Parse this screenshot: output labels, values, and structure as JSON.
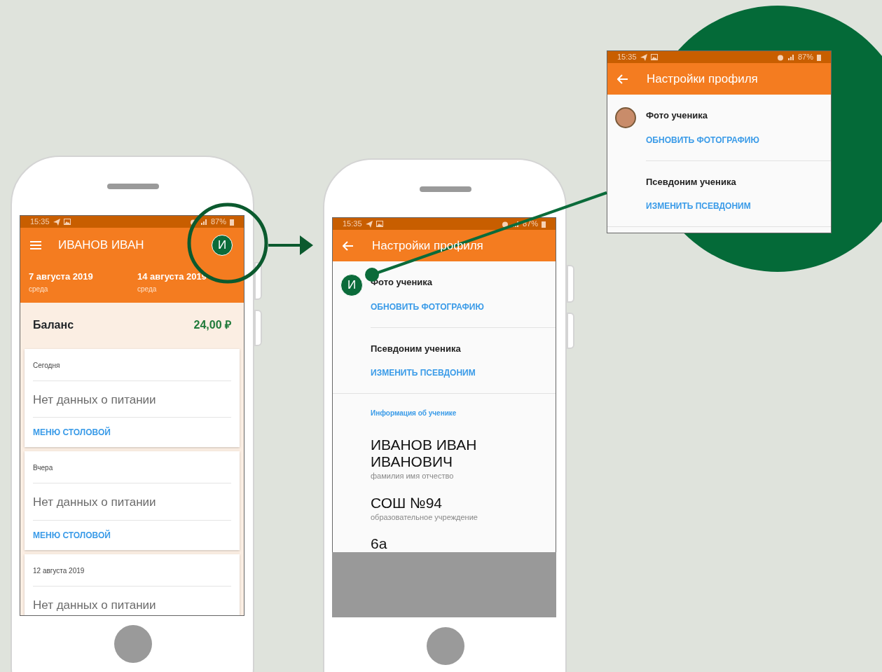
{
  "main_screen": {
    "status_time": "15:35",
    "battery": "87%",
    "title": "ИВАНОВ ИВАН",
    "avatar_letter": "И",
    "weeks": [
      {
        "date": "7 августа 2019",
        "day": "среда"
      },
      {
        "date": "14 августа 2019",
        "day": "среда"
      }
    ],
    "balance_label": "Баланс",
    "balance": "24,00 ₽",
    "days": [
      {
        "label": "Сегодня",
        "message": "Нет данных о питании",
        "link": "МЕНЮ СТОЛОВОЙ"
      },
      {
        "label": "Вчера",
        "message": "Нет данных о питании",
        "link": "МЕНЮ СТОЛОВОЙ"
      },
      {
        "label": "12 августа 2019",
        "message": "Нет данных о питании"
      }
    ]
  },
  "profile_screen": {
    "status_time": "15:35",
    "battery": "87%",
    "title": "Настройки профиля",
    "avatar_letter": "И",
    "rows": [
      {
        "title": "Фото ученика",
        "action": "ОБНОВИТЬ ФОТОГРАФИЮ"
      },
      {
        "title": "Псевдоним ученика",
        "action": "ИЗМЕНИТЬ ПСЕВДОНИМ"
      }
    ],
    "section": "Информация об ученике",
    "fields": [
      {
        "value": "ИВАНОВ ИВАН ИВАНОВИЧ",
        "caption": "фамилия имя отчество"
      },
      {
        "value": "СОШ №94",
        "caption": "образовательное учреждение"
      },
      {
        "value": "6а"
      }
    ]
  },
  "inset": {
    "status_time": "15:35",
    "battery": "87%",
    "title": "Настройки профиля",
    "rows": [
      {
        "title": "Фото ученика",
        "action": "ОБНОВИТЬ ФОТОГРАФИЮ"
      },
      {
        "title": "Псевдоним ученика",
        "action": "ИЗМЕНИТЬ ПСЕВДОНИМ"
      }
    ]
  }
}
